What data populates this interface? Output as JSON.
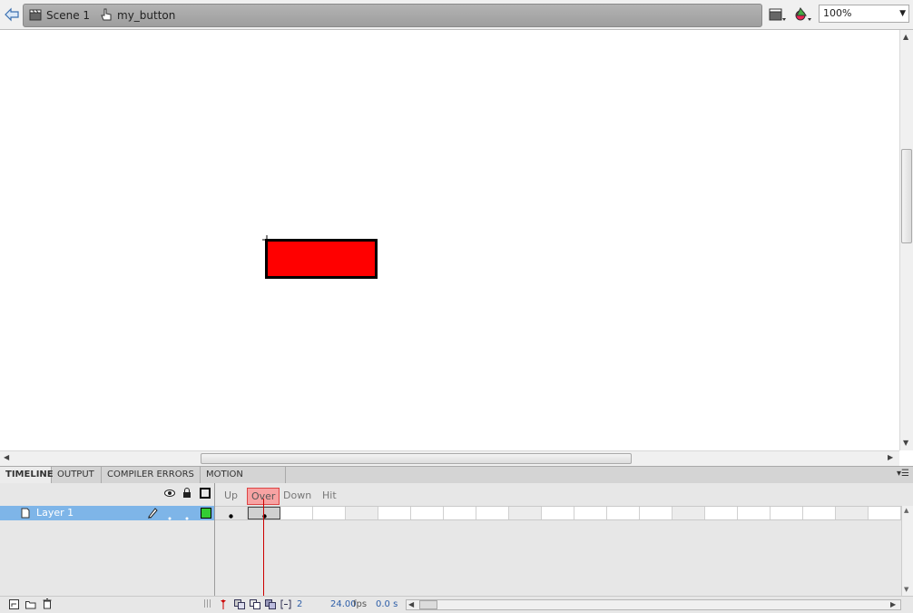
{
  "edit_bar": {
    "scene_label": "Scene 1",
    "symbol_label": "my_button",
    "zoom_value": "100%"
  },
  "panel_tabs": [
    {
      "label": "TIMELINE",
      "active": true
    },
    {
      "label": "OUTPUT",
      "active": false
    },
    {
      "label": "COMPILER ERRORS",
      "active": false
    },
    {
      "label": "MOTION EDITOR",
      "active": false
    }
  ],
  "timeline": {
    "frame_labels": [
      "Up",
      "Over",
      "Down",
      "Hit"
    ],
    "current_label": "Over",
    "layer_name": "Layer 1",
    "current_frame": "2",
    "fps_value": "24.00",
    "fps_unit": "fps",
    "elapsed": "0.0 s"
  },
  "colors": {
    "button_fill": "#ff0000",
    "button_stroke": "#000000",
    "layer_highlight": "#7eb5e8",
    "outline_color": "#33cc33",
    "playhead": "#cc0000"
  }
}
